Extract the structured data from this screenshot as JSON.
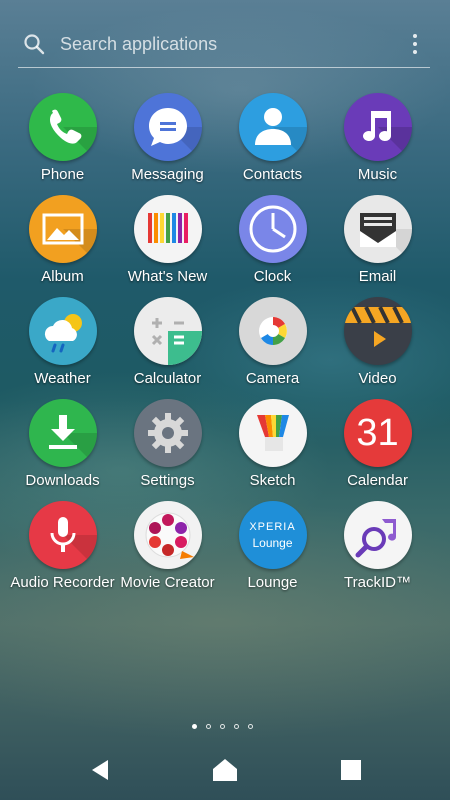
{
  "search": {
    "placeholder": "Search applications"
  },
  "apps": [
    [
      {
        "name": "Phone",
        "color": "#2fb94a",
        "icon": "phone-icon"
      },
      {
        "name": "Messaging",
        "color": "#4e74d8",
        "icon": "message-bubble-icon"
      },
      {
        "name": "Contacts",
        "color": "#2d9ee0",
        "icon": "person-icon"
      },
      {
        "name": "Music",
        "color": "#6a3bb8",
        "icon": "music-note-icon"
      }
    ],
    [
      {
        "name": "Album",
        "color": "#f2a020",
        "icon": "picture-icon"
      },
      {
        "name": "What's New",
        "color": "#f4f4f4",
        "icon": "color-bars-icon"
      },
      {
        "name": "Clock",
        "color": "#7a86e8",
        "icon": "clock-icon"
      },
      {
        "name": "Email",
        "color": "#e8e8e8",
        "icon": "envelope-icon"
      }
    ],
    [
      {
        "name": "Weather",
        "color": "#3aa8c8",
        "icon": "weather-cloud-sun-icon"
      },
      {
        "name": "Calculator",
        "color": "#ececec",
        "icon": "calculator-icon"
      },
      {
        "name": "Camera",
        "color": "#d8d8d8",
        "icon": "camera-lens-icon"
      },
      {
        "name": "Video",
        "color": "#3a3f48",
        "icon": "film-play-icon"
      }
    ],
    [
      {
        "name": "Downloads",
        "color": "#2fb64e",
        "icon": "download-arrow-icon"
      },
      {
        "name": "Settings",
        "color": "#6a7480",
        "icon": "gear-icon"
      },
      {
        "name": "Sketch",
        "color": "#f5f5f5",
        "icon": "rainbow-brush-icon"
      },
      {
        "name": "Calendar",
        "color": "#e53a3a",
        "icon": "calendar-date-icon",
        "date": "31"
      }
    ],
    [
      {
        "name": "Audio Recorder",
        "color": "#e63946",
        "icon": "microphone-icon"
      },
      {
        "name": "Movie Creator",
        "color": "#f2f2f2",
        "icon": "film-reel-icon"
      },
      {
        "name": "Lounge",
        "color": "#1f8fd8",
        "icon": "xperia-lounge-icon",
        "line1": "XPERIA",
        "line2": "Lounge"
      },
      {
        "name": "TrackID™",
        "color": "#f5f5f5",
        "icon": "trackid-search-music-icon"
      }
    ]
  ],
  "pager": {
    "pages": 5,
    "current": 1
  },
  "navbar": {
    "back": "back-icon",
    "home": "home-icon",
    "recents": "recents-icon"
  }
}
